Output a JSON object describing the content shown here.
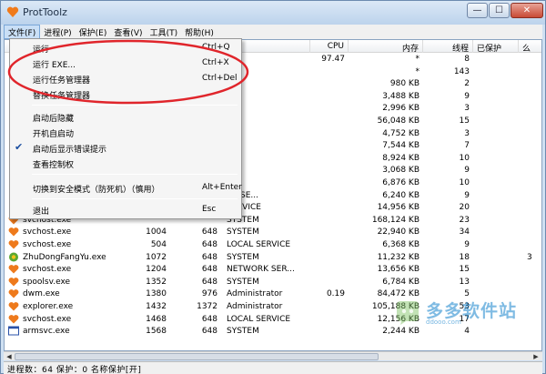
{
  "window": {
    "title": "ProtToolz",
    "min": "—",
    "max": "☐",
    "close": "✕"
  },
  "menubar": [
    {
      "label": "文件(F)"
    },
    {
      "label": "进程(P)"
    },
    {
      "label": "保护(E)"
    },
    {
      "label": "查看(V)"
    },
    {
      "label": "工具(T)"
    },
    {
      "label": "帮助(H)"
    }
  ],
  "columns": [
    {
      "label": ""
    },
    {
      "label": ""
    },
    {
      "label": ""
    },
    {
      "label": ""
    },
    {
      "label": "CPU"
    },
    {
      "label": "内存"
    },
    {
      "label": "线程"
    },
    {
      "label": "已保护"
    },
    {
      "label": "么"
    }
  ],
  "rows": [
    {
      "name": "",
      "pid": "",
      "ppid": "",
      "user": "",
      "cpu": "97.47",
      "mem": "*",
      "threads": "8",
      "extra": ""
    },
    {
      "name": "",
      "pid": "",
      "ppid": "",
      "user": "",
      "cpu": "",
      "mem": "*",
      "threads": "143",
      "extra": ""
    },
    {
      "name": "",
      "pid": "",
      "ppid": "",
      "user": "",
      "cpu": "",
      "mem": "980 KB",
      "threads": "2",
      "extra": ""
    },
    {
      "name": "",
      "pid": "",
      "ppid": "",
      "user": "",
      "cpu": "",
      "mem": "3,488 KB",
      "threads": "9",
      "extra": ""
    },
    {
      "name": "",
      "pid": "",
      "ppid": "",
      "user": "",
      "cpu": "",
      "mem": "2,996 KB",
      "threads": "3",
      "extra": ""
    },
    {
      "name": "",
      "pid": "",
      "ppid": "",
      "user": "",
      "cpu": "",
      "mem": "56,048 KB",
      "threads": "15",
      "extra": ""
    },
    {
      "name": "",
      "pid": "",
      "ppid": "",
      "user": "",
      "cpu": "",
      "mem": "4,752 KB",
      "threads": "3",
      "extra": ""
    },
    {
      "name": "",
      "pid": "",
      "ppid": "",
      "user": "",
      "cpu": "",
      "mem": "7,544 KB",
      "threads": "7",
      "extra": ""
    },
    {
      "name": "",
      "pid": "",
      "ppid": "",
      "user": "",
      "cpu": "",
      "mem": "8,924 KB",
      "threads": "10",
      "extra": ""
    },
    {
      "name": "",
      "pid": "",
      "ppid": "",
      "user": "",
      "cpu": "",
      "mem": "3,068 KB",
      "threads": "9",
      "extra": ""
    },
    {
      "name": "",
      "pid": "",
      "ppid": "",
      "user": "",
      "cpu": "",
      "mem": "6,876 KB",
      "threads": "10",
      "extra": ""
    },
    {
      "name": "",
      "pid": "",
      "ppid": "",
      "user": "RK SE...",
      "cpu": "",
      "mem": "6,240 KB",
      "threads": "9",
      "extra": ""
    },
    {
      "name": "",
      "pid": "",
      "ppid": "",
      "user": "SERVICE",
      "cpu": "",
      "mem": "14,956 KB",
      "threads": "20",
      "extra": ""
    },
    {
      "name": "svchost.exe",
      "pid": "",
      "ppid": "",
      "user": "SYSTEM",
      "cpu": "",
      "mem": "168,124 KB",
      "threads": "23",
      "extra": ""
    },
    {
      "name": "svchost.exe",
      "pid": "1004",
      "ppid": "648",
      "user": "SYSTEM",
      "cpu": "",
      "mem": "22,940 KB",
      "threads": "34",
      "extra": ""
    },
    {
      "name": "svchost.exe",
      "pid": "504",
      "ppid": "648",
      "user": "LOCAL SERVICE",
      "cpu": "",
      "mem": "6,368 KB",
      "threads": "9",
      "extra": ""
    },
    {
      "name": "ZhuDongFangYu.exe",
      "pid": "1072",
      "ppid": "648",
      "user": "SYSTEM",
      "cpu": "",
      "mem": "11,232 KB",
      "threads": "18",
      "extra": "3"
    },
    {
      "name": "svchost.exe",
      "pid": "1204",
      "ppid": "648",
      "user": "NETWORK SER...",
      "cpu": "",
      "mem": "13,656 KB",
      "threads": "15",
      "extra": ""
    },
    {
      "name": "spoolsv.exe",
      "pid": "1352",
      "ppid": "648",
      "user": "SYSTEM",
      "cpu": "",
      "mem": "6,784 KB",
      "threads": "13",
      "extra": ""
    },
    {
      "name": "dwm.exe",
      "pid": "1380",
      "ppid": "976",
      "user": "Administrator",
      "cpu": "0.19",
      "mem": "84,472 KB",
      "threads": "5",
      "extra": ""
    },
    {
      "name": "explorer.exe",
      "pid": "1432",
      "ppid": "1372",
      "user": "Administrator",
      "cpu": "",
      "mem": "105,188 KB",
      "threads": "53",
      "extra": ""
    },
    {
      "name": "svchost.exe",
      "pid": "1468",
      "ppid": "648",
      "user": "LOCAL SERVICE",
      "cpu": "",
      "mem": "12,156 KB",
      "threads": "17",
      "extra": ""
    },
    {
      "name": "armsvc.exe",
      "pid": "1568",
      "ppid": "648",
      "user": "SYSTEM",
      "cpu": "",
      "mem": "2,244 KB",
      "threads": "4",
      "extra": ""
    }
  ],
  "file_menu": [
    {
      "label": "运行",
      "shortcut": "Ctrl+Q"
    },
    {
      "label": "运行 EXE...",
      "shortcut": "Ctrl+X"
    },
    {
      "label": "运行任务管理器",
      "shortcut": "Ctrl+Del"
    },
    {
      "label": "替换任务管理器",
      "shortcut": ""
    },
    {
      "label": "启动后隐藏",
      "shortcut": ""
    },
    {
      "label": "开机自启动",
      "shortcut": ""
    },
    {
      "label": "启动后显示错误提示",
      "shortcut": "",
      "checked": true
    },
    {
      "label": "查看控制权",
      "shortcut": ""
    },
    {
      "label": "切换到安全模式（防死机）（慎用）",
      "shortcut": "Alt+Enter"
    },
    {
      "label": "退出",
      "shortcut": "Esc"
    }
  ],
  "statusbar": {
    "text": "进程数：64  保护：0  名称保护[开]"
  },
  "watermark": {
    "text": "多多软件站",
    "url": "ddooo.com"
  },
  "colors": {
    "accent": "#c9dff6",
    "annotation": "#e0252b",
    "titlebar": "#bcd3ec"
  }
}
